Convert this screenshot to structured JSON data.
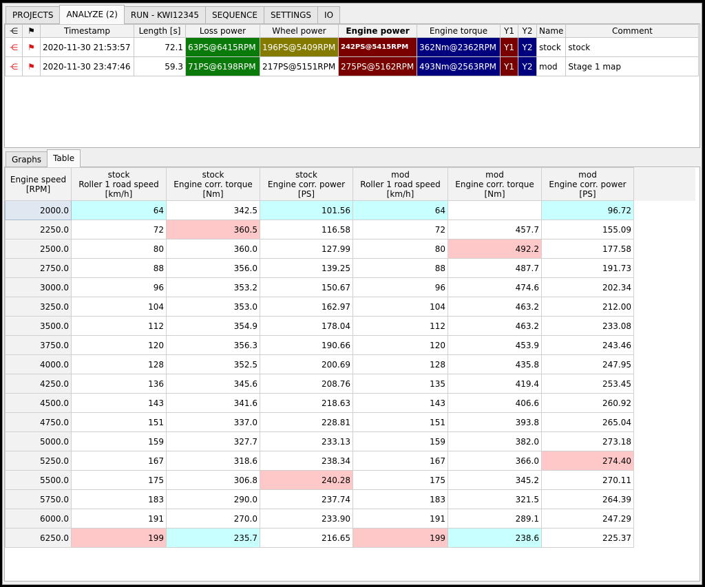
{
  "tabs": [
    "PROJECTS",
    "ANALYZE (2)",
    "RUN - KWI12345",
    "SEQUENCE",
    "SETTINGS",
    "IO"
  ],
  "runs": {
    "headers": [
      "⋲",
      "⚑",
      "Timestamp",
      "Length [s]",
      "Loss power",
      "Wheel power",
      "Engine power",
      "Engine torque",
      "Y1",
      "Y2",
      "Name",
      "Comment"
    ],
    "rows": [
      {
        "icon1": "⋲",
        "icon2": "⚑",
        "timestamp": "2020-11-30 21:53:57",
        "length": "72.1",
        "loss": "63PS@6415RPM",
        "wheel": "196PS@5409RPM",
        "engine": "242PS@5415RPM",
        "torque": "362Nm@2362RPM",
        "y1": "Y1",
        "y2": "Y2",
        "name": "stock",
        "comment": "stock"
      },
      {
        "icon1": "⋲",
        "icon2": "⚑",
        "timestamp": "2020-11-30 23:47:46",
        "length": "59.3",
        "loss": "71PS@6198RPM",
        "wheel": "217PS@5151RPM",
        "engine": "275PS@5162RPM",
        "torque": "493Nm@2563RPM",
        "y1": "Y1",
        "y2": "Y2",
        "name": "mod",
        "comment": "Stage 1 map"
      }
    ]
  },
  "subtabs": [
    "Graphs",
    "Table"
  ],
  "table": {
    "headers": [
      [
        "Engine speed",
        "[RPM]"
      ],
      [
        "stock",
        "Roller 1 road speed",
        "[km/h]"
      ],
      [
        "stock",
        "Engine corr. torque",
        "[Nm]"
      ],
      [
        "stock",
        "Engine corr. power",
        "[PS]"
      ],
      [
        "mod",
        "Roller 1 road speed",
        "[km/h]"
      ],
      [
        "mod",
        "Engine corr. torque",
        "[Nm]"
      ],
      [
        "mod",
        "Engine corr. power",
        "[PS]"
      ]
    ],
    "rows": [
      [
        "2000.0",
        "64",
        "342.5",
        "101.56",
        "64",
        "",
        "96.72"
      ],
      [
        "2250.0",
        "72",
        "360.5",
        "116.58",
        "72",
        "457.7",
        "155.09"
      ],
      [
        "2500.0",
        "80",
        "360.0",
        "127.99",
        "80",
        "492.2",
        "177.58"
      ],
      [
        "2750.0",
        "88",
        "356.0",
        "139.25",
        "88",
        "487.7",
        "191.73"
      ],
      [
        "3000.0",
        "96",
        "353.2",
        "150.67",
        "96",
        "474.6",
        "202.34"
      ],
      [
        "3250.0",
        "104",
        "353.0",
        "162.97",
        "104",
        "463.2",
        "212.00"
      ],
      [
        "3500.0",
        "112",
        "354.9",
        "178.04",
        "112",
        "463.2",
        "233.08"
      ],
      [
        "3750.0",
        "120",
        "356.3",
        "190.66",
        "120",
        "453.9",
        "243.46"
      ],
      [
        "4000.0",
        "128",
        "352.5",
        "200.69",
        "128",
        "435.8",
        "247.95"
      ],
      [
        "4250.0",
        "136",
        "345.6",
        "208.76",
        "135",
        "419.4",
        "253.45"
      ],
      [
        "4500.0",
        "143",
        "341.6",
        "218.63",
        "143",
        "406.6",
        "260.92"
      ],
      [
        "4750.0",
        "151",
        "337.0",
        "228.81",
        "151",
        "393.8",
        "265.04"
      ],
      [
        "5000.0",
        "159",
        "327.7",
        "233.13",
        "159",
        "382.0",
        "273.18"
      ],
      [
        "5250.0",
        "167",
        "318.6",
        "238.34",
        "167",
        "366.0",
        "274.40"
      ],
      [
        "5500.0",
        "175",
        "306.8",
        "240.28",
        "175",
        "345.2",
        "270.11"
      ],
      [
        "5750.0",
        "183",
        "290.0",
        "237.74",
        "183",
        "321.5",
        "264.39"
      ],
      [
        "6000.0",
        "191",
        "270.0",
        "233.90",
        "191",
        "289.1",
        "247.29"
      ],
      [
        "6250.0",
        "199",
        "235.7",
        "216.65",
        "199",
        "238.6",
        "225.37"
      ]
    ],
    "highlights": {
      "cyan": [
        "0-1",
        "0-3",
        "0-4",
        "0-6",
        "17-2",
        "17-5"
      ],
      "pink": [
        "1-2",
        "2-5",
        "13-6",
        "14-3",
        "17-1",
        "17-4"
      ]
    }
  }
}
